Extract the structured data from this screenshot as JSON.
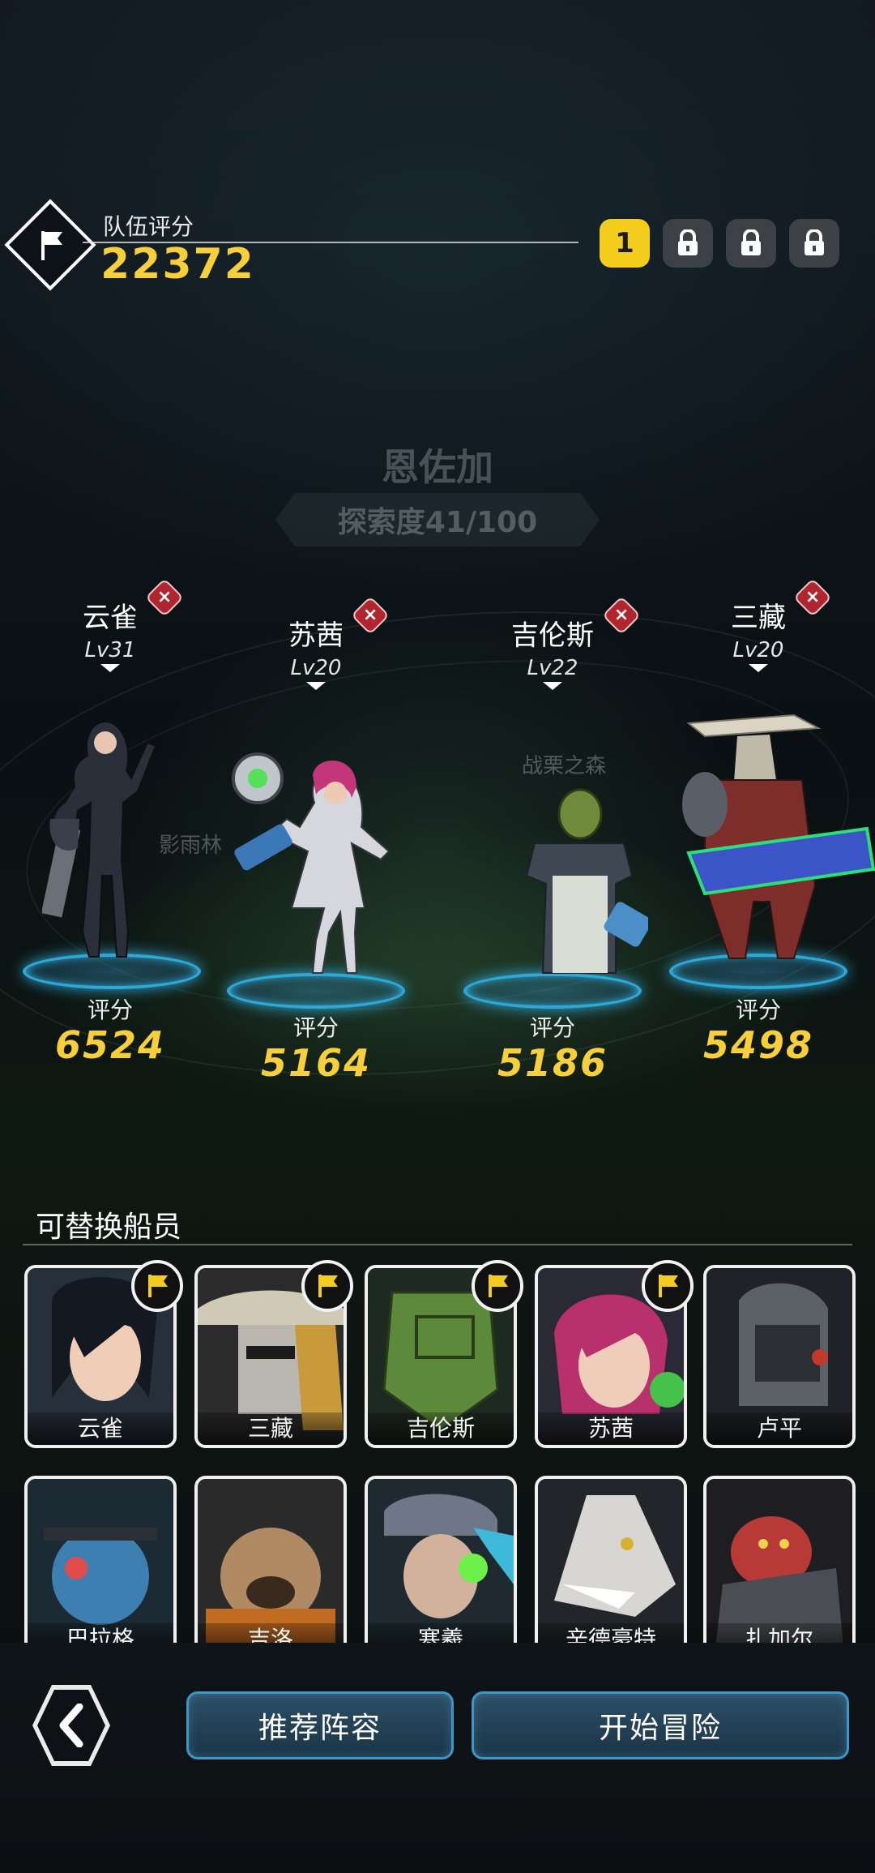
{
  "header": {
    "team_label": "队伍评分",
    "team_score": "22372",
    "slots": [
      {
        "label": "1",
        "state": "active"
      },
      {
        "label": "",
        "state": "locked"
      },
      {
        "label": "",
        "state": "locked"
      },
      {
        "label": "",
        "state": "locked"
      }
    ]
  },
  "location": {
    "name": "恩佐加",
    "progress": "探索度41/100",
    "ghost_labels": [
      "影雨林",
      "战栗之森"
    ]
  },
  "heroes": [
    {
      "name": "云雀",
      "level": "Lv31",
      "score_label": "评分",
      "score": "6524"
    },
    {
      "name": "苏茜",
      "level": "Lv20",
      "score_label": "评分",
      "score": "5164"
    },
    {
      "name": "吉伦斯",
      "level": "Lv22",
      "score_label": "评分",
      "score": "5186"
    },
    {
      "name": "三藏",
      "level": "Lv20",
      "score_label": "评分",
      "score": "5498"
    }
  ],
  "crew": {
    "title": "可替换船员",
    "members": [
      {
        "name": "云雀",
        "in_team": true
      },
      {
        "name": "三藏",
        "in_team": true
      },
      {
        "name": "吉伦斯",
        "in_team": true
      },
      {
        "name": "苏茜",
        "in_team": true
      },
      {
        "name": "卢平",
        "in_team": false
      },
      {
        "name": "巴拉格",
        "in_team": false
      },
      {
        "name": "吉洛",
        "in_team": false
      },
      {
        "name": "寒羲",
        "in_team": false
      },
      {
        "name": "辛德豪特",
        "in_team": false
      },
      {
        "name": "扎加尔",
        "in_team": false
      }
    ]
  },
  "actions": {
    "back_icon": "chevron-left-icon",
    "recommend": "推荐阵容",
    "start": "开始冒险"
  },
  "colors": {
    "gold": "#f6cf3a",
    "platform": "#2fa8d8",
    "remove": "#b0262e",
    "button": "#2c4f66"
  }
}
